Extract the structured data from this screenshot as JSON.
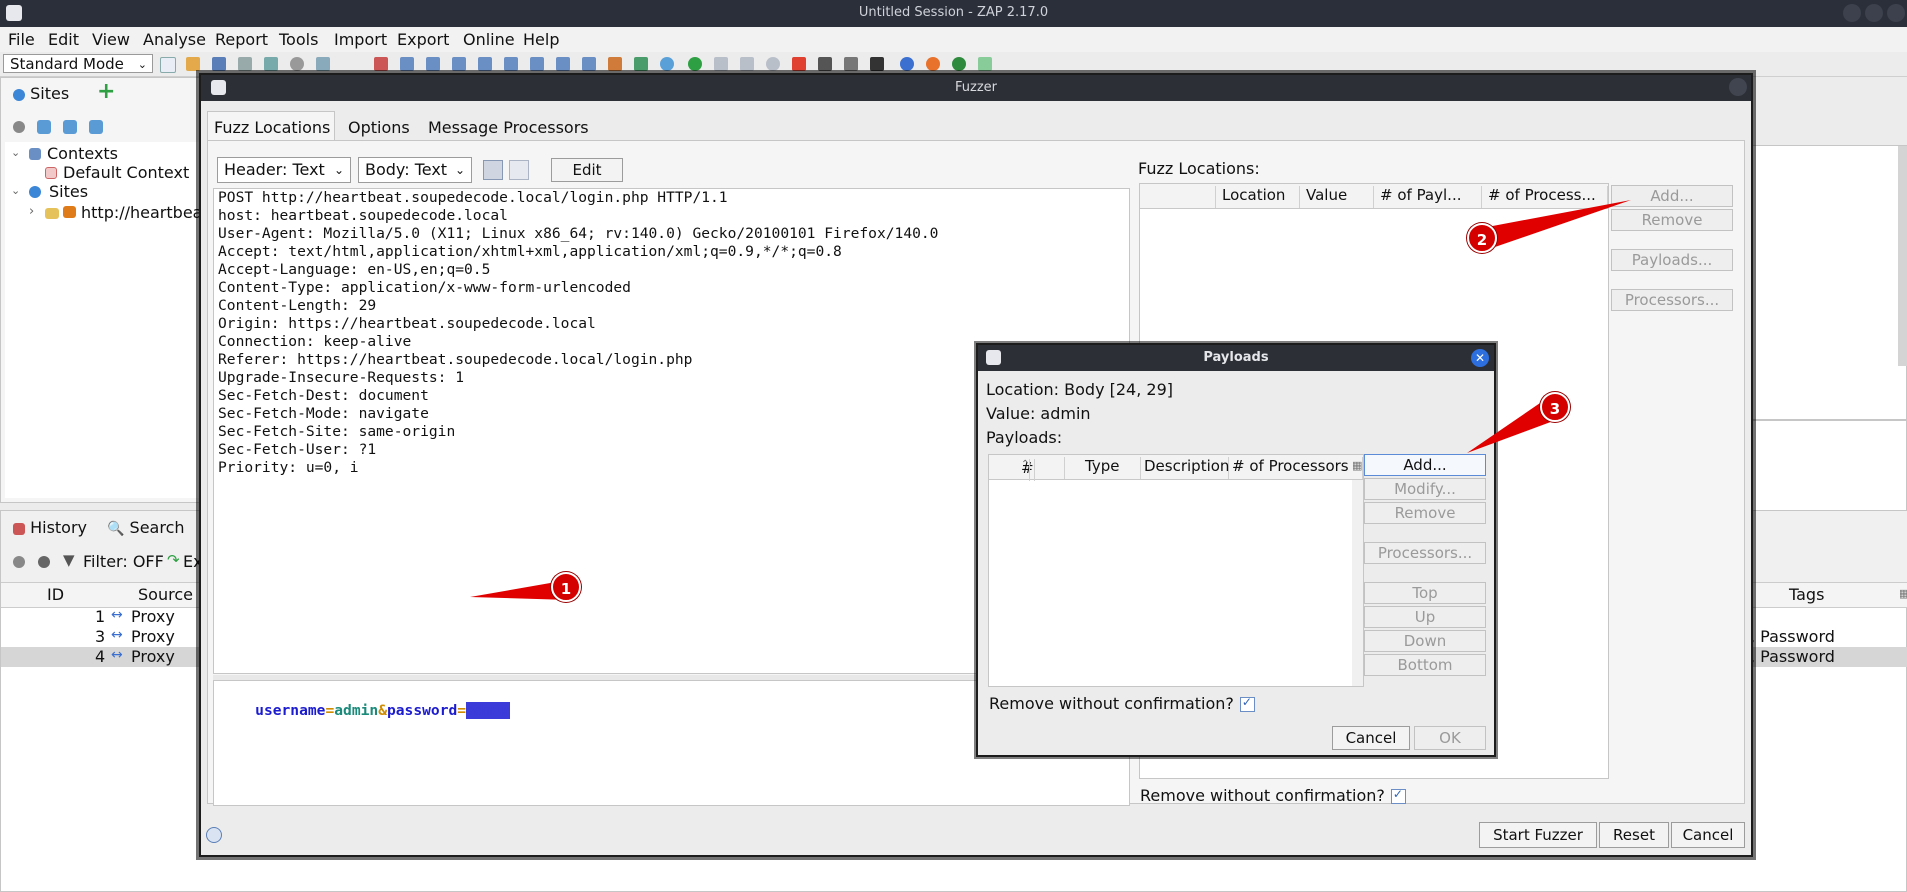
{
  "window": {
    "title": "Untitled Session - ZAP 2.17.0"
  },
  "menu": [
    "File",
    "Edit",
    "View",
    "Analyse",
    "Report",
    "Tools",
    "Import",
    "Export",
    "Online",
    "Help"
  ],
  "toolbar": {
    "mode": "Standard Mode"
  },
  "sites_panel": {
    "tab": "Sites",
    "tree": {
      "contexts": "Contexts",
      "default_context": "Default Context",
      "sites": "Sites",
      "site_node": "http://heartbea"
    }
  },
  "history_panel": {
    "tabs": {
      "history": "History",
      "search": "Search"
    },
    "filter": "Filter: OFF",
    "export_partial": "Ex",
    "columns": {
      "id": "ID",
      "source": "Source",
      "tags": "Tags"
    },
    "rows": [
      {
        "id": "1",
        "source": "Proxy",
        "tags": ""
      },
      {
        "id": "3",
        "source": "Proxy",
        "tags": ", Password"
      },
      {
        "id": "4",
        "source": "Proxy",
        "tags": ", Password"
      }
    ]
  },
  "fuzzer": {
    "title": "Fuzzer",
    "tabs": [
      "Fuzz Locations",
      "Options",
      "Message Processors"
    ],
    "header_select": "Header: Text",
    "body_select": "Body: Text",
    "edit_button": "Edit",
    "request_lines": [
      "POST http://heartbeat.soupedecode.local/login.php HTTP/1.1",
      "host: heartbeat.soupedecode.local",
      "User-Agent: Mozilla/5.0 (X11; Linux x86_64; rv:140.0) Gecko/20100101 Firefox/140.0",
      "Accept: text/html,application/xhtml+xml,application/xml;q=0.9,*/*;q=0.8",
      "Accept-Language: en-US,en;q=0.5",
      "Content-Type: application/x-www-form-urlencoded",
      "Content-Length: 29",
      "Origin: https://heartbeat.soupedecode.local",
      "Connection: keep-alive",
      "Referer: https://heartbeat.soupedecode.local/login.php",
      "Upgrade-Insecure-Requests: 1",
      "Sec-Fetch-Dest: document",
      "Sec-Fetch-Mode: navigate",
      "Sec-Fetch-Site: same-origin",
      "Sec-Fetch-User: ?1",
      "Priority: u=0, i"
    ],
    "body": {
      "key1": "username",
      "eq1": "=",
      "val1": "admin",
      "amp": "&",
      "key2": "password",
      "eq2": "=",
      "selected": "admin"
    },
    "fuzz_locations_label": "Fuzz Locations:",
    "locations_columns": [
      "Location",
      "Value",
      "# of Payl...",
      "# of Process..."
    ],
    "side_buttons": {
      "add": "Add...",
      "remove": "Remove",
      "payloads": "Payloads...",
      "processors": "Processors..."
    },
    "remove_without_confirmation": "Remove without confirmation?",
    "footer_buttons": {
      "start": "Start Fuzzer",
      "reset": "Reset",
      "cancel": "Cancel"
    }
  },
  "payloads_dialog": {
    "title": "Payloads",
    "location": "Location: Body [24, 29]",
    "value": "Value: admin",
    "payloads_label": "Payloads:",
    "columns": [
      "#",
      "Type",
      "Description",
      "# of Processors"
    ],
    "buttons": {
      "add": "Add...",
      "modify": "Modify...",
      "remove": "Remove",
      "processors": "Processors...",
      "top": "Top",
      "up": "Up",
      "down": "Down",
      "bottom": "Bottom"
    },
    "remove_without_confirmation": "Remove without confirmation?",
    "cancel": "Cancel",
    "ok": "OK"
  },
  "annotations": [
    "1",
    "2",
    "3"
  ],
  "colors": {
    "accent": "#d40000",
    "selection": "#3b3bd9",
    "key": "#1c1ccf",
    "value": "#1a8a7a",
    "amp": "#d08c00"
  }
}
